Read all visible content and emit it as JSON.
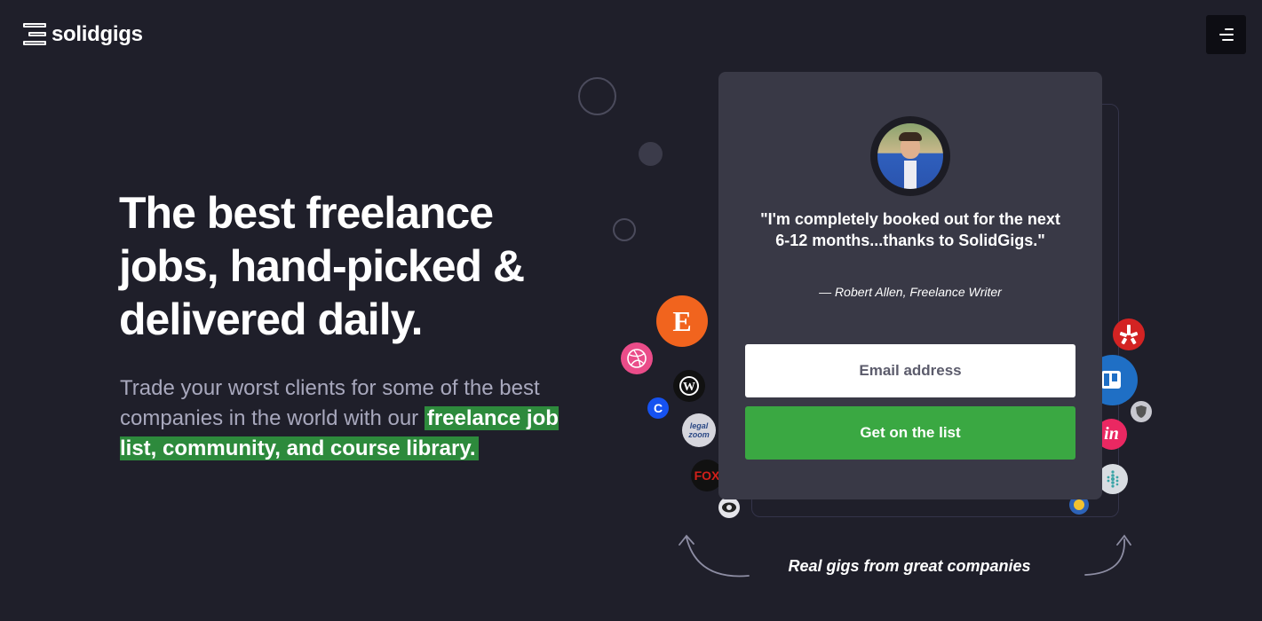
{
  "brand": {
    "name": "solidgigs",
    "logo_icon": "stacked-bars-logo-icon"
  },
  "nav": {
    "menu_icon": "hamburger-menu-icon"
  },
  "hero": {
    "headline": "The best freelance jobs, hand-picked & delivered daily.",
    "subtext_plain": "Trade your worst clients for some of the best companies in the world with our ",
    "subtext_highlight": "freelance job list, community, and course library."
  },
  "testimonial": {
    "quote": "\"I'm completely booked out for the next 6-12 months...thanks to SolidGigs.\"",
    "author": "— Robert Allen, Freelance Writer"
  },
  "signup": {
    "email_placeholder": "Email address",
    "email_value": "",
    "button_label": "Get on the list"
  },
  "tagline": "Real gigs from great companies",
  "company_logos": {
    "etsy": {
      "letter": "E",
      "color": "#f1641e"
    },
    "fox": {
      "label": "FOX",
      "color": "#d3201a"
    },
    "legalzoom": {
      "line1": "legal",
      "line2": "zoom"
    },
    "coinbase": {
      "letter": "C",
      "color": "#1652f0"
    },
    "invision": {
      "label": "in",
      "color": "#ea2862"
    },
    "yelp": {
      "color": "#d32323"
    },
    "trello": {
      "color": "#1f6fc5"
    }
  },
  "colors": {
    "background": "#1f1f2a",
    "card": "#393946",
    "accent_green": "#3aa842",
    "highlight_green": "#2d8a3c"
  }
}
